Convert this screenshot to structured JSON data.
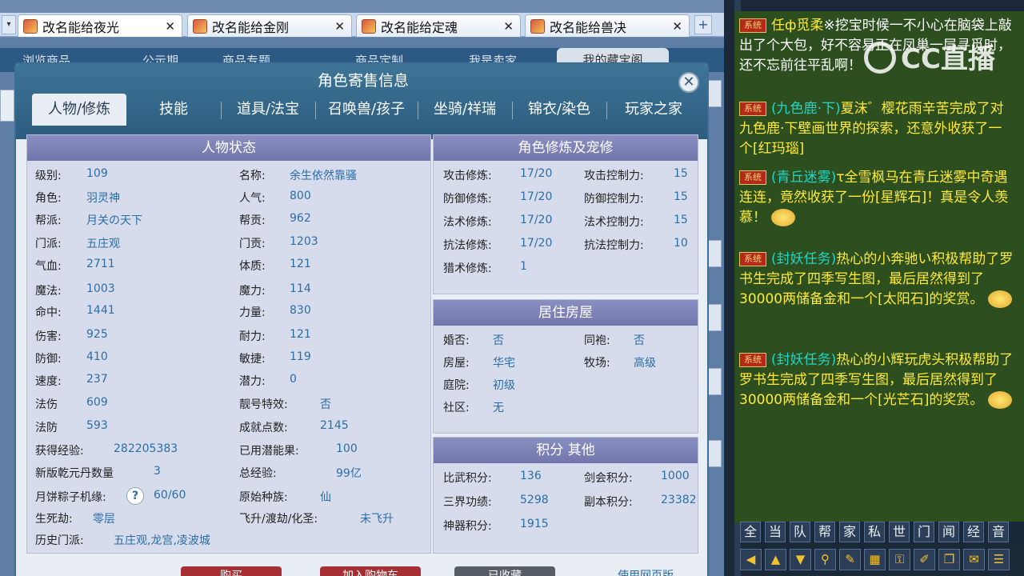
{
  "tabs": [
    {
      "label": "改名能给夜光",
      "active": true
    },
    {
      "label": "改名能给金刚",
      "active": false
    },
    {
      "label": "改名能给定魂",
      "active": false
    },
    {
      "label": "改名能给兽决",
      "active": false
    }
  ],
  "page_nav": [
    "浏览商品",
    "公示期",
    "商品专题",
    "商品定制",
    "我是卖家",
    "我的藏宝阁"
  ],
  "modal": {
    "title": "角色寄售信息",
    "close": "✕",
    "tabs": [
      "人物/修炼",
      "技能",
      "道具/法宝",
      "召唤兽/孩子",
      "坐骑/祥瑞",
      "锦衣/染色",
      "玩家之家"
    ]
  },
  "status": {
    "header": "人物状态",
    "left_col": [
      {
        "label": "级别:",
        "value": "109"
      },
      {
        "label": "角色:",
        "value": "羽灵神"
      },
      {
        "label": "帮派:",
        "value": "月关の天下"
      },
      {
        "label": "门派:",
        "value": "五庄观"
      },
      {
        "label": "气血:",
        "value": "2711"
      },
      {
        "label": "魔法:",
        "value": "1003"
      },
      {
        "label": "命中:",
        "value": "1441"
      },
      {
        "label": "伤害:",
        "value": "925"
      },
      {
        "label": "防御:",
        "value": "410"
      },
      {
        "label": "速度:",
        "value": "237"
      },
      {
        "label": "法伤",
        "value": "609"
      },
      {
        "label": "法防",
        "value": "593"
      }
    ],
    "right_col": [
      {
        "label": "名称:",
        "value": "余生依然靠骚"
      },
      {
        "label": "人气:",
        "value": "800"
      },
      {
        "label": "帮贡:",
        "value": "962"
      },
      {
        "label": "门贡:",
        "value": "1203"
      },
      {
        "label": "体质:",
        "value": "121"
      },
      {
        "label": "魔力:",
        "value": "114"
      },
      {
        "label": "力量:",
        "value": "830"
      },
      {
        "label": "耐力:",
        "value": "121"
      },
      {
        "label": "敏捷:",
        "value": "119"
      },
      {
        "label": "潜力:",
        "value": "0"
      },
      {
        "label": "靓号特效:",
        "value": "否"
      },
      {
        "label": "成就点数:",
        "value": "2145"
      }
    ],
    "extra": {
      "exp_label": "获得经验:",
      "exp_value": "282205383",
      "used_label": "已用潜能果:",
      "used_value": "100",
      "qk_label": "新版乾元丹数量",
      "qk_value": "3",
      "total_label": "总经验:",
      "total_value": "99亿",
      "yb_label": "月饼粽子机缘:",
      "yb_help": "?",
      "yb_value": "60/60",
      "race_label": "原始种族:",
      "race_value": "仙",
      "sj_label": "生死劫:",
      "sj_value": "零层",
      "fs_label": "飞升/渡劫/化圣:",
      "fs_value": "未飞升",
      "hist_label": "历史门派:",
      "hist_value": "五庄观,龙宫,凌波城"
    }
  },
  "cultivation": {
    "header": "角色修炼及宠修",
    "rows": [
      {
        "l1": "攻击修炼:",
        "v1": "17/20",
        "l2": "攻击控制力:",
        "v2": "15"
      },
      {
        "l1": "防御修炼:",
        "v1": "17/20",
        "l2": "防御控制力:",
        "v2": "15"
      },
      {
        "l1": "法术修炼:",
        "v1": "17/20",
        "l2": "法术控制力:",
        "v2": "15"
      },
      {
        "l1": "抗法修炼:",
        "v1": "17/20",
        "l2": "抗法控制力:",
        "v2": "10"
      },
      {
        "l1": "猎术修炼:",
        "v1": "1",
        "l2": "",
        "v2": ""
      }
    ]
  },
  "housing": {
    "header": "居住房屋",
    "rows": [
      {
        "l1": "婚否:",
        "v1": "否",
        "l2": "同袍:",
        "v2": "否"
      },
      {
        "l1": "房屋:",
        "v1": "华宅",
        "l2": "牧场:",
        "v2": "高级"
      },
      {
        "l1": "庭院:",
        "v1": "初级",
        "l2": "",
        "v2": ""
      },
      {
        "l1": "社区:",
        "v1": "无",
        "l2": "",
        "v2": ""
      }
    ]
  },
  "points": {
    "header": "积分 其他",
    "rows": [
      {
        "l1": "比武积分:",
        "v1": "136",
        "l2": "剑会积分:",
        "v2": "1000"
      },
      {
        "l1": "三界功绩:",
        "v1": "5298",
        "l2": "副本积分:",
        "v2": "23382"
      },
      {
        "l1": "神器积分:",
        "v1": "1915",
        "l2": "",
        "v2": ""
      }
    ]
  },
  "bottom_buttons": [
    "购买",
    "加入购物车",
    "已收藏",
    "使用网页版"
  ],
  "chat": {
    "system_tag": "系统",
    "messages": [
      {
        "name": "任ф觅柔",
        "text": "※挖宝时候一不小心在脑袋上敲出了个大包，好不容易正在凤巢一层寻觅时，还不忘前往平乱啊！"
      },
      {
        "name": "(九色鹿·下)",
        "text": "夏沫゛樱花雨辛苦完成了对九色鹿·下壁画世界的探索，还意外收获了一个[红玛瑙]"
      },
      {
        "name": "(青丘迷雾)",
        "text": "τ全雪枫马在青丘迷雾中奇遇连连，竟然收获了一份[星辉石]！真是令人羡慕！"
      },
      {
        "name": "(封妖任务)",
        "text": "热心的小奔驰い积极帮助了罗书生完成了四季写生图，最后居然得到了30000两储备金和一个[太阳石]的奖赏。"
      },
      {
        "name": "(封妖任务)",
        "text": "热心的小辉玩虎头积极帮助了罗书生完成了四季写生图，最后居然得到了30000两储备金和一个[光芒石]的奖赏。"
      }
    ],
    "quick_buttons": [
      "全",
      "当",
      "队",
      "帮",
      "家",
      "私",
      "世",
      "门",
      "闻",
      "经",
      "音"
    ],
    "watermark": "CC直播"
  }
}
